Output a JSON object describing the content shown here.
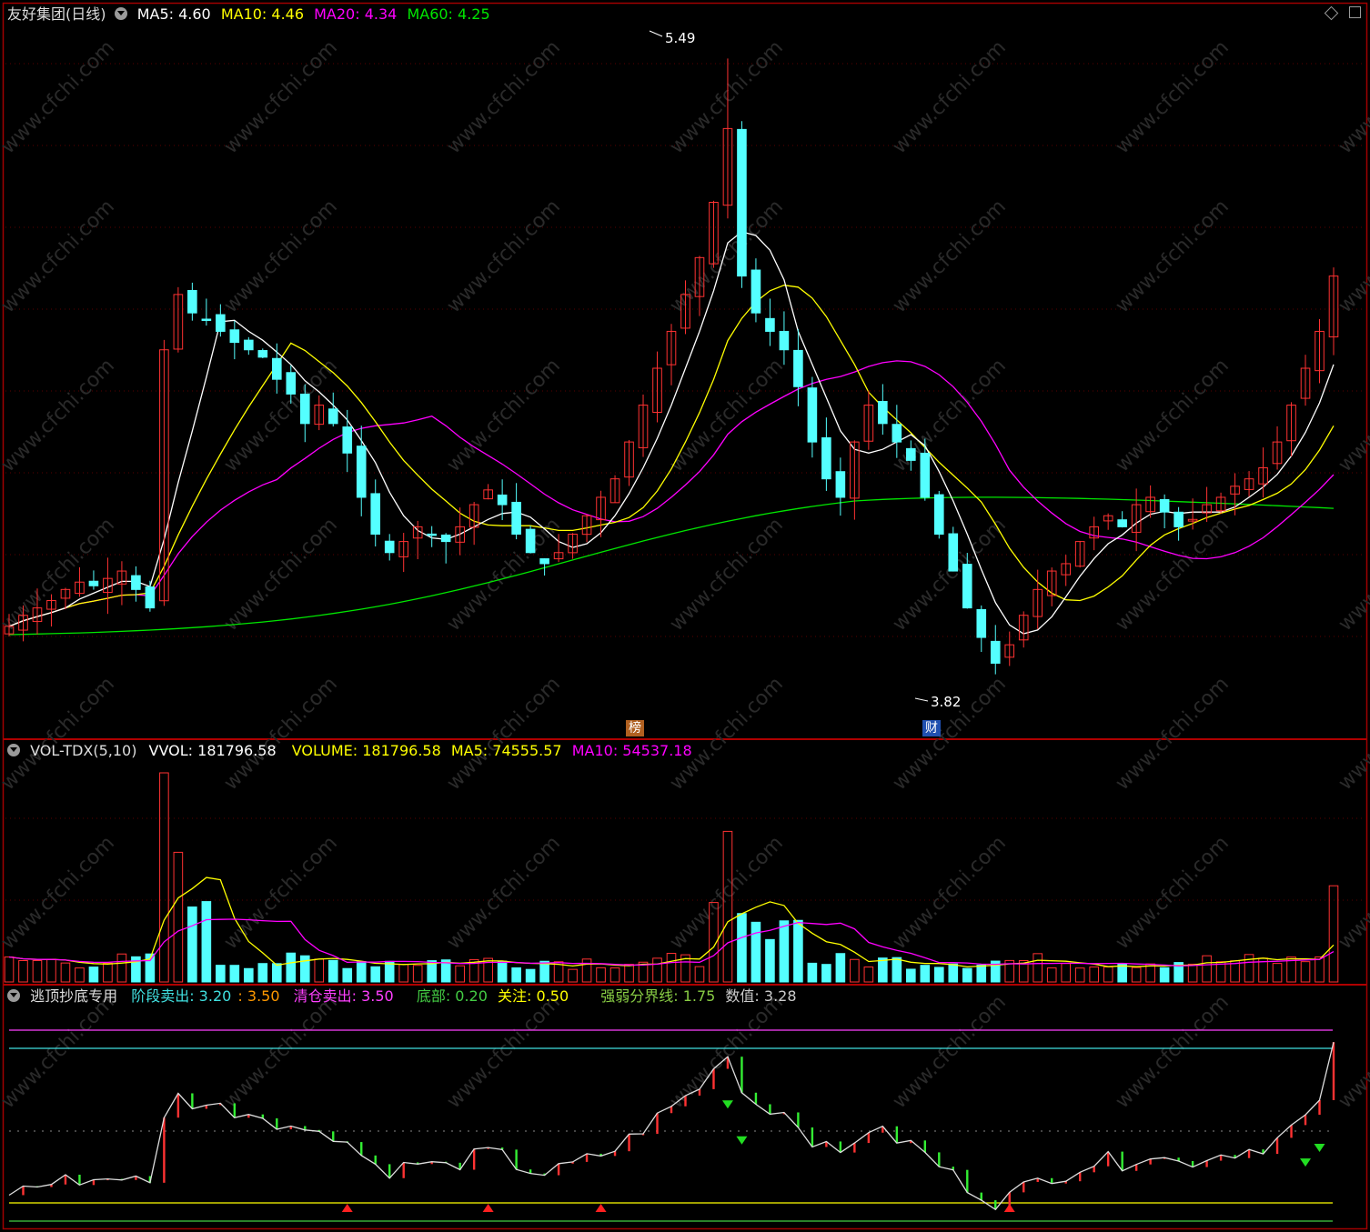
{
  "main": {
    "title": "友好集团(日线)",
    "ma5": "MA5: 4.60",
    "ma10": "MA10: 4.46",
    "ma20": "MA20: 4.34",
    "ma60": "MA60: 4.25",
    "high_label": "5.49",
    "low_label": "3.82",
    "badge_bang": "榜",
    "badge_cai": "财"
  },
  "vol": {
    "name": "VOL-TDX(5,10)",
    "vvol": "VVOL: 181796.58",
    "volume": "VOLUME: 181796.58",
    "ma5": "MA5: 74555.57",
    "ma10": "MA10: 54537.18"
  },
  "ind": {
    "name": "逃顶抄底专用",
    "stage_sell": "阶段卖出: 3.20",
    "stage_sell2": ": 3.50",
    "clear_sell": "清仓卖出: 3.50",
    "bottom": "底部: 0.20",
    "watch": "关注: 0.50",
    "strength_line": "强弱分界线: 1.75",
    "value": "数值: 3.28"
  },
  "colors": {
    "up": "#ff3232",
    "down": "#54ffff",
    "ma5": "#ffffff",
    "ma10": "#ffff00",
    "ma20": "#ff00ff",
    "ma60": "#00e600",
    "border": "#b00000",
    "grid": "#5a0000"
  },
  "chart_data": [
    {
      "type": "candlestick",
      "title": "友好集团(日线)",
      "ylim": [
        3.7,
        5.6
      ],
      "series_close": [
        3.95,
        3.98,
        4.0,
        4.02,
        4.05,
        4.07,
        4.06,
        4.08,
        4.1,
        4.05,
        4.0,
        4.7,
        4.85,
        4.8,
        4.78,
        4.75,
        4.72,
        4.7,
        4.68,
        4.62,
        4.58,
        4.5,
        4.55,
        4.5,
        4.42,
        4.3,
        4.2,
        4.15,
        4.18,
        4.22,
        4.2,
        4.18,
        4.22,
        4.28,
        4.32,
        4.28,
        4.2,
        4.15,
        4.12,
        4.15,
        4.2,
        4.25,
        4.3,
        4.35,
        4.45,
        4.55,
        4.65,
        4.75,
        4.85,
        4.95,
        5.1,
        5.3,
        4.9,
        4.8,
        4.75,
        4.7,
        4.6,
        4.45,
        4.35,
        4.3,
        4.45,
        4.55,
        4.5,
        4.45,
        4.4,
        4.3,
        4.2,
        4.1,
        4.0,
        3.92,
        3.85,
        3.9,
        3.98,
        4.05,
        4.1,
        4.12,
        4.18,
        4.22,
        4.25,
        4.22,
        4.28,
        4.3,
        4.26,
        4.22,
        4.24,
        4.28,
        4.3,
        4.33,
        4.35,
        4.38,
        4.45,
        4.55,
        4.65,
        4.75,
        4.9
      ],
      "high": 5.49,
      "low": 3.82,
      "ma_latest": {
        "MA5": 4.6,
        "MA10": 4.46,
        "MA20": 4.34,
        "MA60": 4.25
      }
    },
    {
      "type": "bar",
      "title": "VOL-TDX(5,10)",
      "VVOL": 181796.58,
      "VOLUME": 181796.58,
      "MA5": 74555.57,
      "MA10": 54537.18
    },
    {
      "type": "line",
      "title": "逃顶抄底专用",
      "thresholds": {
        "阶段卖出": 3.2,
        "清仓卖出": 3.5,
        "底部": 0.2,
        "关注": 0.5,
        "强弱分界线": 1.75
      },
      "latest_value": 3.28,
      "ylim": [
        0,
        3.8
      ]
    }
  ]
}
